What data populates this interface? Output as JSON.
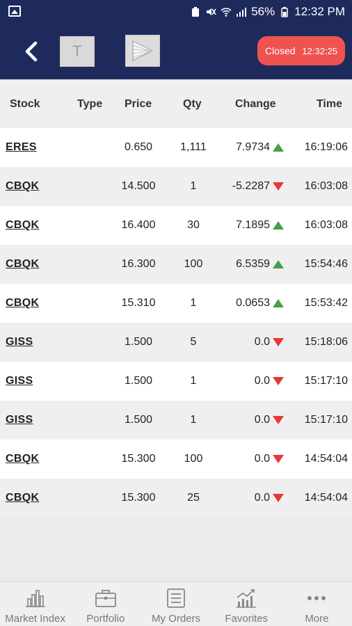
{
  "status_bar": {
    "battery": "56%",
    "time": "12:32 PM"
  },
  "header": {
    "logo_letter": "T",
    "market_status": "Closed",
    "market_time": "12:32:25"
  },
  "table": {
    "columns": [
      "Stock",
      "Type",
      "Price",
      "Qty",
      "Change",
      "Time"
    ],
    "rows": [
      {
        "stock": "ERES",
        "type": "",
        "price": "0.650",
        "qty": "1,111",
        "change": "7.9734",
        "direction": "up",
        "time": "16:19:06"
      },
      {
        "stock": "CBQK",
        "type": "",
        "price": "14.500",
        "qty": "1",
        "change": "-5.2287",
        "direction": "down",
        "time": "16:03:08"
      },
      {
        "stock": "CBQK",
        "type": "",
        "price": "16.400",
        "qty": "30",
        "change": "7.1895",
        "direction": "up",
        "time": "16:03:08"
      },
      {
        "stock": "CBQK",
        "type": "",
        "price": "16.300",
        "qty": "100",
        "change": "6.5359",
        "direction": "up",
        "time": "15:54:46"
      },
      {
        "stock": "CBQK",
        "type": "",
        "price": "15.310",
        "qty": "1",
        "change": "0.0653",
        "direction": "up",
        "time": "15:53:42"
      },
      {
        "stock": "GISS",
        "type": "",
        "price": "1.500",
        "qty": "5",
        "change": "0.0",
        "direction": "down",
        "time": "15:18:06"
      },
      {
        "stock": "GISS",
        "type": "",
        "price": "1.500",
        "qty": "1",
        "change": "0.0",
        "direction": "down",
        "time": "15:17:10"
      },
      {
        "stock": "GISS",
        "type": "",
        "price": "1.500",
        "qty": "1",
        "change": "0.0",
        "direction": "down",
        "time": "15:17:10"
      },
      {
        "stock": "CBQK",
        "type": "",
        "price": "15.300",
        "qty": "100",
        "change": "0.0",
        "direction": "down",
        "time": "14:54:04"
      },
      {
        "stock": "CBQK",
        "type": "",
        "price": "15.300",
        "qty": "25",
        "change": "0.0",
        "direction": "down",
        "time": "14:54:04"
      }
    ]
  },
  "bottom_nav": [
    {
      "label": "Market Index",
      "icon": "bar-chart-icon"
    },
    {
      "label": "Portfolio",
      "icon": "briefcase-icon"
    },
    {
      "label": "My Orders",
      "icon": "list-icon"
    },
    {
      "label": "Favorites",
      "icon": "trend-chart-icon"
    },
    {
      "label": "More",
      "icon": "more-dots-icon"
    }
  ],
  "colors": {
    "header_bg": "#1f2a5c",
    "closed_pill": "#ef5350",
    "up": "#43a047",
    "down": "#e53935"
  }
}
